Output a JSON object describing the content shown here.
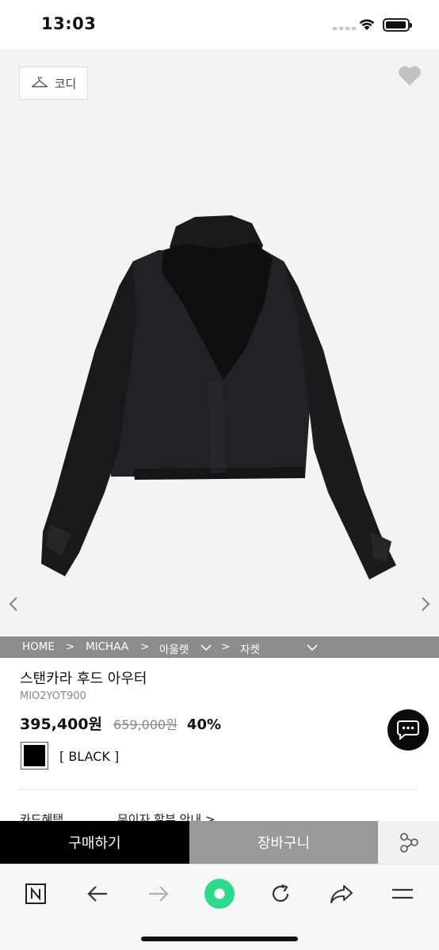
{
  "status_bar": {
    "time": "13:03"
  },
  "image_area": {
    "codi_label": "코디",
    "background_color": "#f3f3f3"
  },
  "breadcrumb": {
    "items": [
      "HOME",
      ">",
      "MICHAA",
      ">",
      "아울렛",
      ">",
      "자켓"
    ]
  },
  "product": {
    "name": "스탠카라 후드 아우터",
    "code": "MIO2YOT900",
    "price": "395,400원",
    "original_price": "659,000원",
    "discount": "40%",
    "color_option": "[ BLACK ]",
    "card_benefit": "카드혜택",
    "installment_info": "무이자 할부 안내 >"
  },
  "actions": {
    "buy": "구매하기",
    "cart": "장바구니"
  },
  "colors": {
    "buy_bg": "#000000",
    "cart_bg": "#999999",
    "breadcrumb_bg": "#8c8c8c",
    "reload_accent": "#2fd98c"
  },
  "icons": [
    "hanger-icon",
    "heart-icon",
    "chevron-left-icon",
    "chevron-right-icon",
    "chevron-down-icon",
    "chat-icon",
    "share-icon",
    "naver-n-icon",
    "back-arrow-icon",
    "forward-arrow-icon",
    "green-dot-icon",
    "reload-icon",
    "share-arrow-icon",
    "menu-icon"
  ]
}
